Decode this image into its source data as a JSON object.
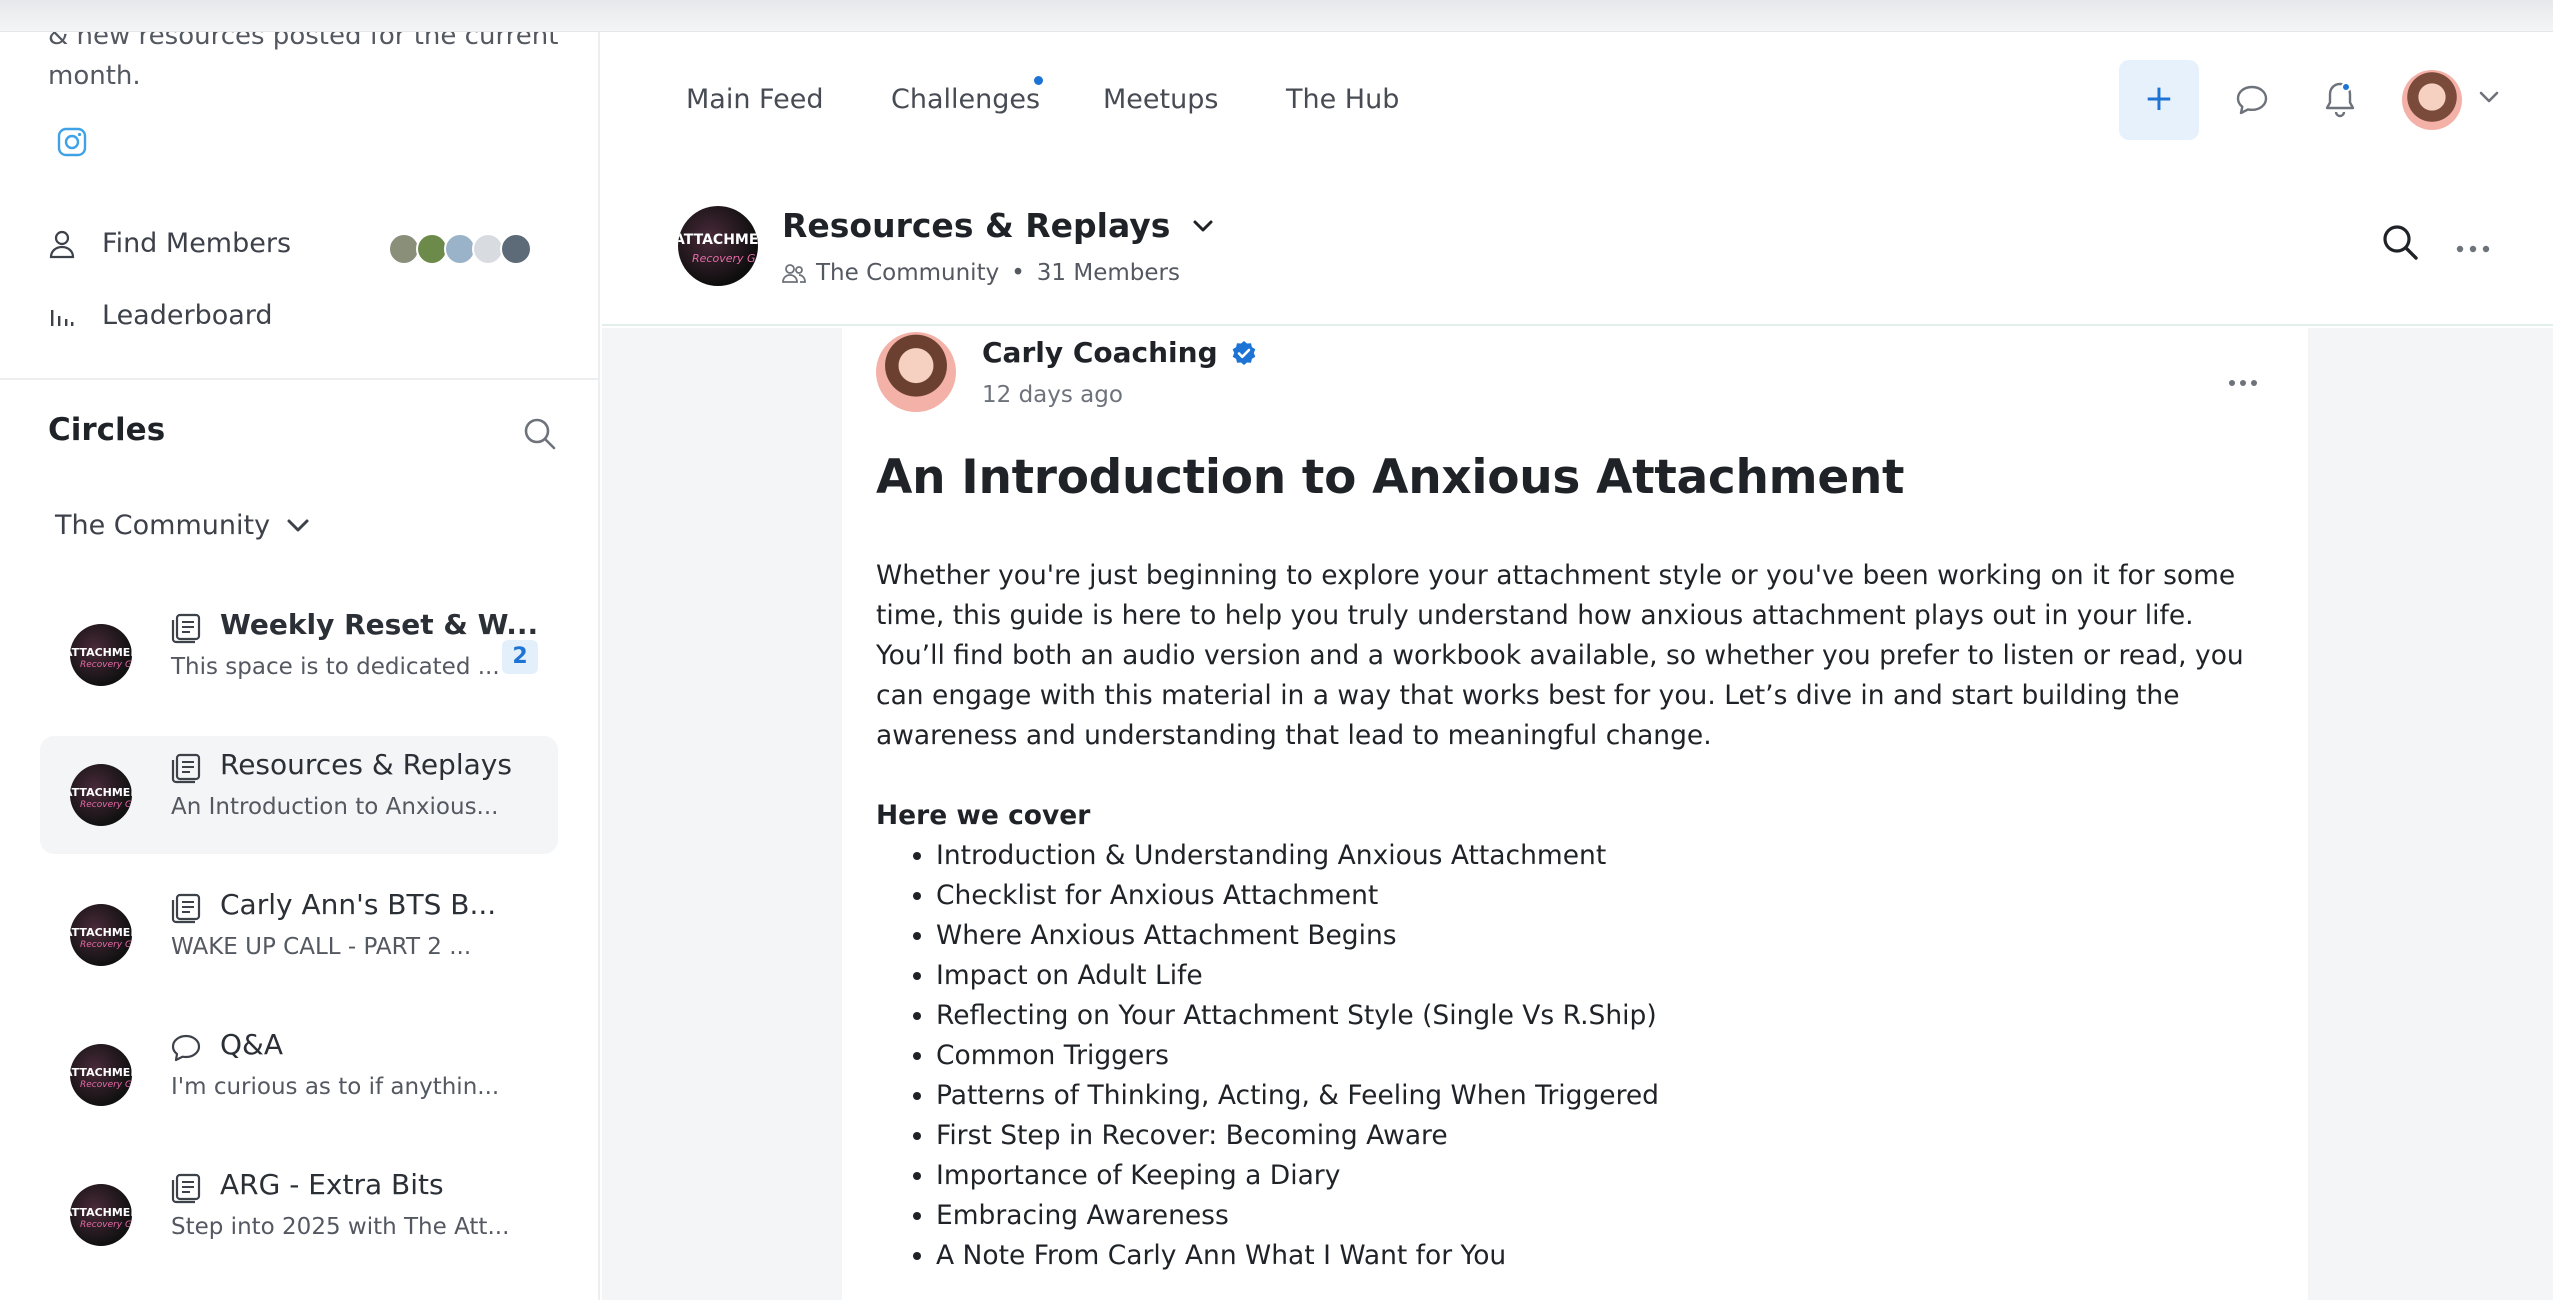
{
  "sidebar": {
    "description": "& new resources posted for the current month.",
    "instagram_icon": "instagram-icon",
    "find_members": "Find Members",
    "leaderboard": "Leaderboard",
    "circles_title": "Circles",
    "community_select": "The Community",
    "spaces": [
      {
        "name": "Weekly Reset & W...",
        "sub": "This space is to dedicated ...",
        "badge": "2",
        "bold": true,
        "icon": "post-icon"
      },
      {
        "name": "Resources & Replays",
        "sub": "An Introduction to Anxious...",
        "active": true,
        "icon": "post-icon"
      },
      {
        "name": "Carly Ann's BTS B...",
        "sub": "WAKE UP CALL - PART 2 ...",
        "icon": "post-icon"
      },
      {
        "name": "Q&A",
        "sub": "I'm curious as to if anythin...",
        "icon": "chat-icon"
      },
      {
        "name": "ARG - Extra Bits",
        "sub": "Step into 2025 with The Att...",
        "icon": "post-icon"
      }
    ],
    "thumb_text": "ATTACHMENT",
    "thumb_script": "Recovery Guide"
  },
  "nav": {
    "items": [
      "Main Feed",
      "Challenges",
      "Meetups",
      "The Hub"
    ],
    "plus": "+"
  },
  "space_header": {
    "title": "Resources & Replays",
    "community": "The Community",
    "separator": "•",
    "members": "31 Members"
  },
  "post": {
    "author": "Carly Coaching",
    "time": "12 days ago",
    "title": "An Introduction to Anxious Attachment",
    "para1": "Whether you're just beginning to explore your attachment style or you've been working on it for some time, this guide is here to help you truly understand how anxious attachment plays out in your life.",
    "para2": "You’ll find both an audio version and a workbook available, so whether you prefer to listen or read, you can engage with this material in a way that works best for you. Let’s dive in and start building the awareness and understanding that lead to meaningful change.",
    "cover_heading": "Here we cover",
    "topics": [
      "Introduction & Understanding Anxious Attachment",
      "Checklist for Anxious Attachment",
      "Where Anxious Attachment Begins",
      "Impact on Adult Life",
      "Reflecting on Your Attachment Style (Single Vs R.Ship)",
      "Common Triggers",
      "Patterns of Thinking, Acting, & Feeling When Triggered",
      "First Step in Recover: Becoming Aware",
      "Importance of Keeping a Diary",
      "Embracing Awareness",
      "A Note From Carly Ann What I Want for You"
    ]
  },
  "colors": {
    "accent": "#1e74d4",
    "badge_bg": "#e3f0fc",
    "active_bg": "#f4f5f6",
    "feed_bg": "#f4f5f6"
  }
}
